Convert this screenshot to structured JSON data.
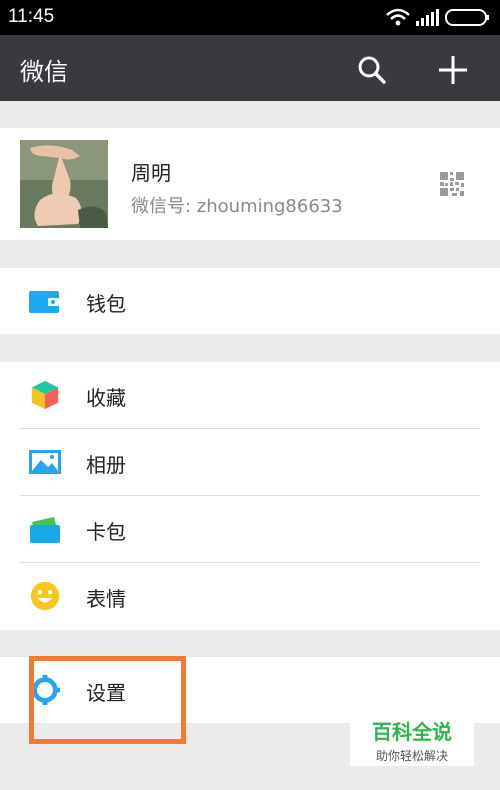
{
  "status_bar": {
    "time": "11:45"
  },
  "app_bar": {
    "title": "微信"
  },
  "profile": {
    "name": "周明",
    "wechat_id": "微信号: zhouming86633"
  },
  "menu": {
    "wallet": "钱包",
    "favorites": "收藏",
    "album": "相册",
    "cards": "卡包",
    "stickers": "表情",
    "settings": "设置"
  },
  "watermark": {
    "title": "百科全说",
    "subtitle": "助你轻松解决"
  }
}
